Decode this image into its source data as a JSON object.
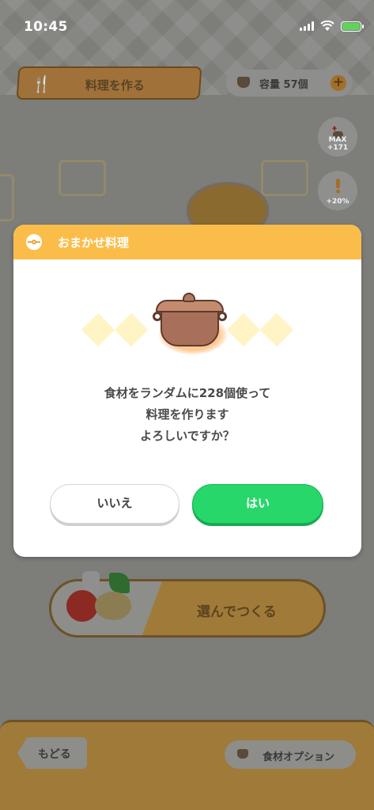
{
  "status_bar": {
    "time": "10:45",
    "icons": [
      "cellular-signal",
      "wifi",
      "battery-charging"
    ]
  },
  "background": {
    "cook_tab_label": "料理を作る",
    "capacity_label": "容量 57個",
    "side_badges": [
      {
        "icon": "pot-up-arrow",
        "text": "MAX +171"
      },
      {
        "icon": "exclamation",
        "text": "+20%"
      }
    ],
    "choose_button_label": "選んでつくる",
    "back_button_label": "もどる",
    "ingredient_option_label": "食材オプション"
  },
  "dialog": {
    "title": "おまかせ料理",
    "message_lines": [
      "食材をランダムに228個使って",
      "料理を作ります",
      "よろしいですか？"
    ],
    "no_label": "いいえ",
    "yes_label": "はい"
  },
  "colors": {
    "dialog_header": "#fbbd4a",
    "yes_button": "#27d76a",
    "no_button": "#ffffff",
    "diamond": "#fff4c6",
    "overlay": "#7d7d7a"
  }
}
